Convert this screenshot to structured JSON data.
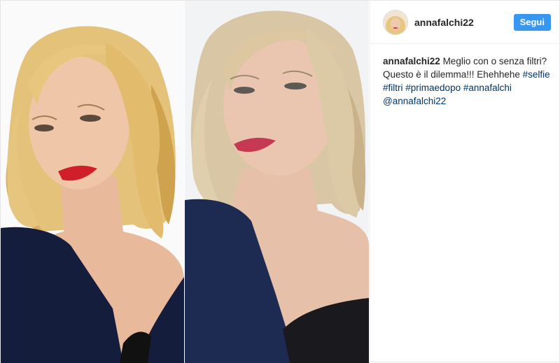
{
  "post": {
    "username": "annafalchi22",
    "follow_label": "Segui",
    "caption": {
      "username": "annafalchi22",
      "line1": "Meglio con o senza filtri?",
      "line2": "Questo è il dilemma!!! Ehehhehe",
      "hashtags": [
        "#selfie",
        "#filtri",
        "#primaedopo",
        "#annafalchi"
      ],
      "mention": "@annafalchi22"
    }
  },
  "colors": {
    "follow_button": "#3897f0",
    "link": "#003569",
    "text": "#262626"
  },
  "icons": {
    "avatar": "profile-avatar"
  }
}
